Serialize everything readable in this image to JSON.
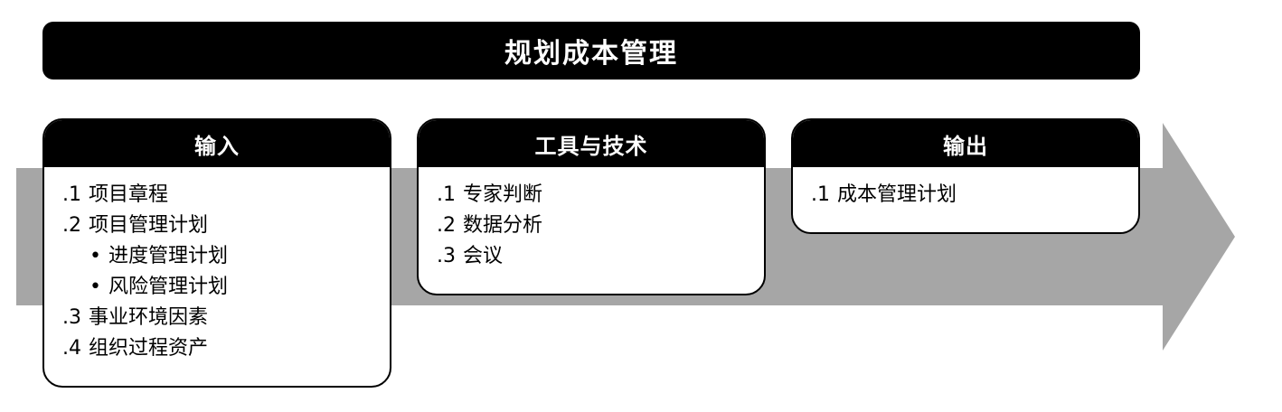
{
  "title": "规划成本管理",
  "colors": {
    "header_bg": "#000000",
    "header_text": "#ffffff",
    "arrow": "#a6a6a6",
    "box_bg": "#ffffff"
  },
  "inputs": {
    "header": "输入",
    "items": [
      {
        "num": ".1",
        "label": "项目章程"
      },
      {
        "num": ".2",
        "label": "项目管理计划"
      },
      {
        "num": ".3",
        "label": "事业环境因素"
      },
      {
        "num": ".4",
        "label": "组织过程资产"
      }
    ],
    "sub_items": [
      {
        "bullet": "•",
        "label": "进度管理计划"
      },
      {
        "bullet": "•",
        "label": "风险管理计划"
      }
    ]
  },
  "tools": {
    "header": "工具与技术",
    "items": [
      {
        "num": ".1",
        "label": "专家判断"
      },
      {
        "num": ".2",
        "label": "数据分析"
      },
      {
        "num": ".3",
        "label": "会议"
      }
    ]
  },
  "outputs": {
    "header": "输出",
    "items": [
      {
        "num": ".1",
        "label": "成本管理计划"
      }
    ]
  }
}
